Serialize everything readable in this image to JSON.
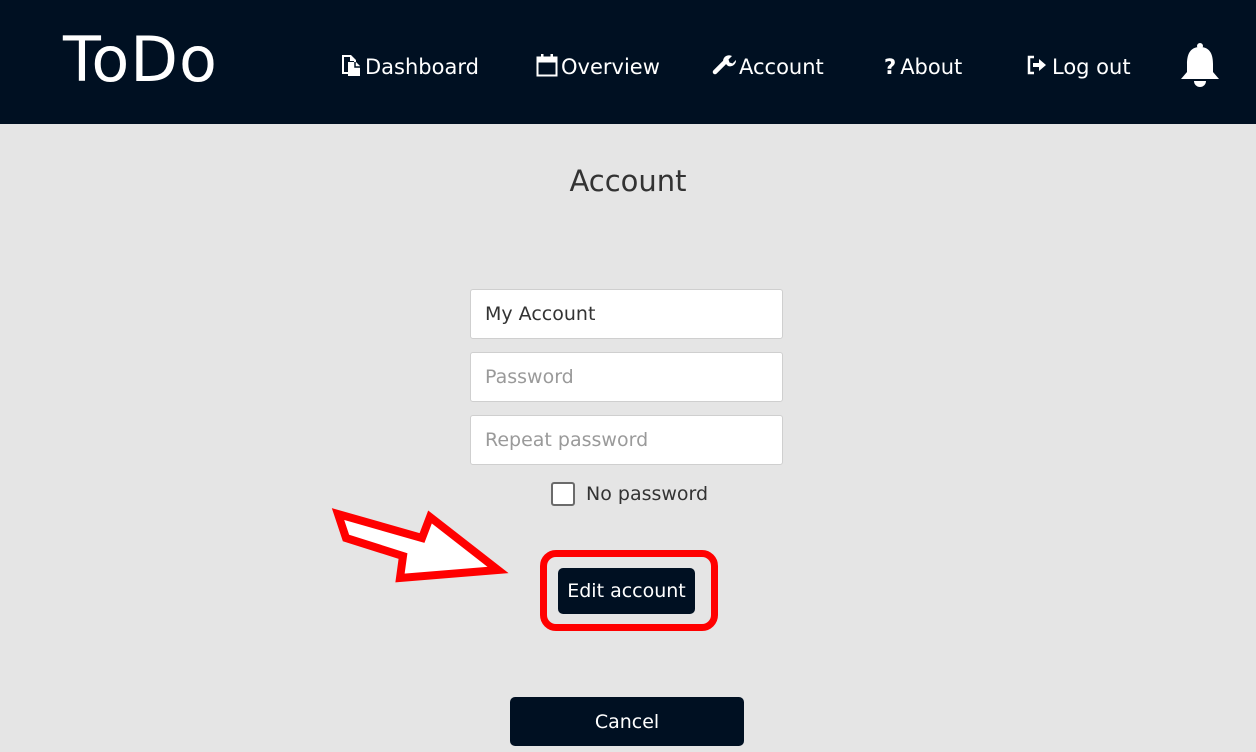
{
  "nav": {
    "brand": "ToDo",
    "items": [
      {
        "label": "Dashboard",
        "icon": "document-icon"
      },
      {
        "label": "Overview",
        "icon": "calendar-icon"
      },
      {
        "label": "Account",
        "icon": "wrench-icon"
      },
      {
        "label": "About",
        "icon": "question-icon"
      },
      {
        "label": "Log out",
        "icon": "logout-icon"
      }
    ],
    "notifications_icon": "bell-icon"
  },
  "page": {
    "title": "Account"
  },
  "form": {
    "account_name_value": "My Account",
    "password_placeholder": "Password",
    "repeat_password_placeholder": "Repeat password",
    "no_password_label": "No password",
    "edit_button": "Edit account",
    "cancel_button": "Cancel"
  },
  "annotation": {
    "color": "#ff0000"
  },
  "colors": {
    "navbar": "#001022",
    "background": "#e5e5e5",
    "button": "#001022"
  }
}
